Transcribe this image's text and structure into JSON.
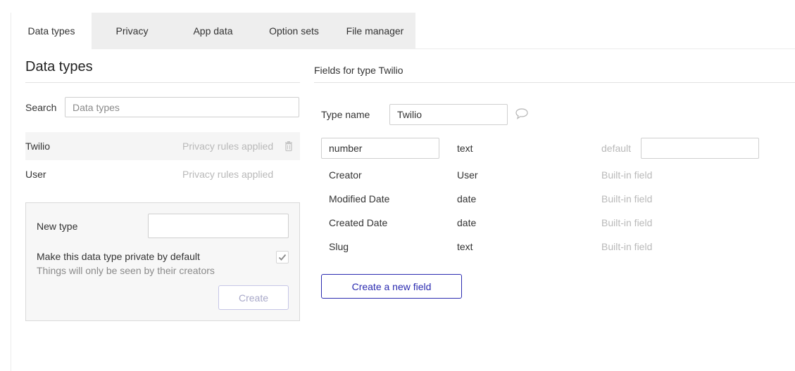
{
  "tabs": [
    {
      "label": "Data types",
      "active": true
    },
    {
      "label": "Privacy",
      "active": false
    },
    {
      "label": "App data",
      "active": false
    },
    {
      "label": "Option sets",
      "active": false
    },
    {
      "label": "File manager",
      "active": false
    }
  ],
  "left_panel": {
    "title": "Data types",
    "search_label": "Search",
    "search_placeholder": "Data types",
    "types": [
      {
        "name": "Twilio",
        "privacy": "Privacy rules applied",
        "selected": true
      },
      {
        "name": "User",
        "privacy": "Privacy rules applied",
        "selected": false
      }
    ],
    "new_type": {
      "label": "New type",
      "value": "",
      "private_label": "Make this data type private by default",
      "private_help": "Things will only be seen by their creators",
      "private_checked": true,
      "create_label": "Create"
    }
  },
  "right_panel": {
    "title": "Fields for type Twilio",
    "type_name_label": "Type name",
    "type_name_value": "Twilio",
    "editable_field": {
      "name": "number",
      "type": "text",
      "default_label": "default",
      "default_value": ""
    },
    "builtin_fields": [
      {
        "name": "Creator",
        "type": "User",
        "note": "Built-in field"
      },
      {
        "name": "Modified Date",
        "type": "date",
        "note": "Built-in field"
      },
      {
        "name": "Created Date",
        "type": "date",
        "note": "Built-in field"
      },
      {
        "name": "Slug",
        "type": "text",
        "note": "Built-in field"
      }
    ],
    "new_field_label": "Create a new field"
  },
  "colors": {
    "accent": "#2b2bb0",
    "muted_text": "#b9b9b9",
    "tab_bar": "#eeeeee"
  },
  "icons": {
    "trash": "trash-icon",
    "comment": "comment-icon",
    "checkmark": "checkmark-icon"
  }
}
